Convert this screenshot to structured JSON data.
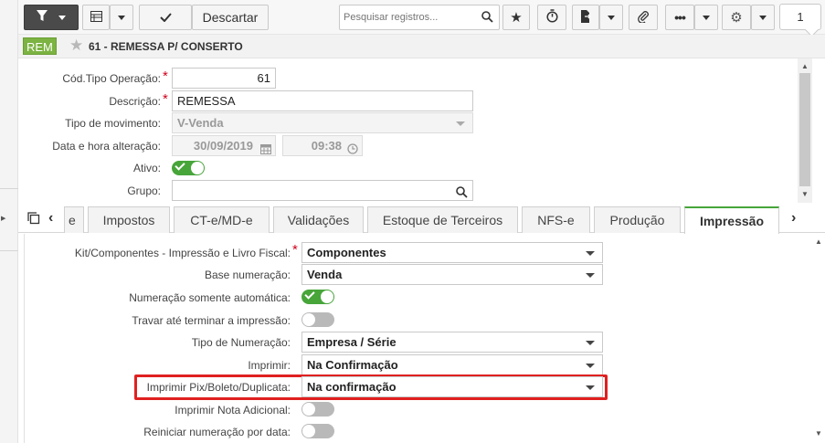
{
  "toolbar": {
    "discard_label": "Descartar",
    "search_placeholder": "Pesquisar registros...",
    "page_number": "1"
  },
  "record": {
    "badge": "REM",
    "title": "61 - REMESSA P/ CONSERTO"
  },
  "form": {
    "cod_tipo_operacao": {
      "label": "Cód.Tipo Operação:",
      "value": "61"
    },
    "descricao": {
      "label": "Descrição:",
      "value": "REMESSA"
    },
    "tipo_movimento": {
      "label": "Tipo de movimento:",
      "value": "V-Venda"
    },
    "data_hora": {
      "label": "Data e hora alteração:",
      "date": "30/09/2019",
      "time": "09:38"
    },
    "ativo": {
      "label": "Ativo:",
      "checked": true
    },
    "grupo": {
      "label": "Grupo:",
      "value": ""
    }
  },
  "tabs": [
    {
      "label": "e"
    },
    {
      "label": "Impostos"
    },
    {
      "label": "CT-e/MD-e"
    },
    {
      "label": "Validações"
    },
    {
      "label": "Estoque de Terceiros"
    },
    {
      "label": "NFS-e"
    },
    {
      "label": "Produção"
    },
    {
      "label": "Impressão",
      "active": true
    }
  ],
  "impressao": {
    "kit_componentes": {
      "label": "Kit/Componentes - Impressão e Livro Fiscal:",
      "value": "Componentes"
    },
    "base_numeracao": {
      "label": "Base numeração:",
      "value": "Venda"
    },
    "numeracao_automatica": {
      "label": "Numeração somente automática:",
      "checked": true
    },
    "travar_impressao": {
      "label": "Travar até terminar a impressão:",
      "checked": false
    },
    "tipo_numeracao": {
      "label": "Tipo de Numeração:",
      "value": "Empresa / Série"
    },
    "imprimir": {
      "label": "Imprimir:",
      "value": "Na Confirmação"
    },
    "imprimir_pix": {
      "label": "Imprimir Pix/Boleto/Duplicata:",
      "value": "Na confirmação"
    },
    "imprimir_nota_adicional": {
      "label": "Imprimir Nota Adicional:",
      "checked": false
    },
    "reiniciar_numeracao": {
      "label": "Reiniciar numeração por data:",
      "checked": false
    }
  },
  "colors": {
    "accent_green": "#47a53a",
    "badge_green": "#7cb342",
    "required_red": "#d0021b",
    "highlight_red": "#e02020"
  }
}
